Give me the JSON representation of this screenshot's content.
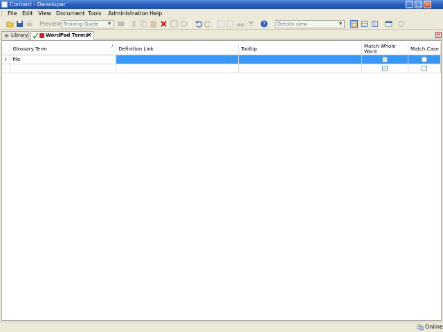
{
  "window": {
    "title": "Content - Developer"
  },
  "menu": [
    "File",
    "Edit",
    "View",
    "Document",
    "Tools",
    "Administration",
    "Help"
  ],
  "toolbar": {
    "preview_label": "Preview",
    "training_combo": "Training Guide",
    "view_combo": "Details view"
  },
  "tabs": [
    {
      "label": "Library"
    },
    {
      "label": "WordPad Terms"
    }
  ],
  "grid": {
    "columns": [
      "Glossary Term",
      "Definition Link",
      "Tooltip",
      "Match Whole Word",
      "Match Case"
    ],
    "sort_indicator": "/",
    "rows": [
      {
        "indicator": "I",
        "term": "file",
        "definition": "",
        "tooltip": "",
        "match_whole_word": true,
        "match_case": false
      },
      {
        "indicator": "",
        "term": "",
        "definition": "",
        "tooltip": "",
        "match_whole_word": true,
        "match_case": false
      }
    ]
  },
  "status": {
    "online": "Online"
  },
  "colors": {
    "selection": "#3399ff",
    "titlebar": "#2a5fc0"
  }
}
